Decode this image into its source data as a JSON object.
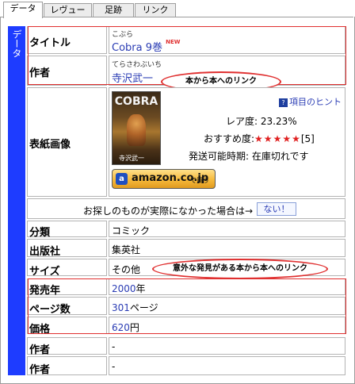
{
  "tabs": [
    {
      "label": "データ",
      "active": true
    },
    {
      "label": "レヴュー",
      "active": false
    },
    {
      "label": "足跡",
      "active": false
    },
    {
      "label": "リンク",
      "active": false
    }
  ],
  "sidebar": {
    "label": "データ"
  },
  "title": {
    "label": "タイトル",
    "ruby": "こぶら",
    "value": "Cobra 9巻",
    "badge": "NEW"
  },
  "author": {
    "label": "作者",
    "ruby": "てらさわぶいち",
    "value": "寺沢武一"
  },
  "annotations": {
    "author_link": "本から本へのリンク",
    "discovery_link": "意外な発見がある本から本へのリンク"
  },
  "cover": {
    "label": "表紙画像",
    "image_text": "COBRA",
    "image_author": "寺沢武一",
    "hint": "項目のヒント",
    "rarity_label": "レア度:",
    "rarity_value": "23.23%",
    "recommend_label": "おすすめ度:",
    "recommend_stars": "★★★★★",
    "recommend_rating": 5,
    "recommend_count": "[5]",
    "shipping_label": "発送可能時期:",
    "shipping_value": "在庫切れです",
    "amazon_logo": "amazon.co.jp",
    "amazon_buy": "で買う"
  },
  "notfound": {
    "text": "お探しのものが実際になかった場合は→",
    "button": "ない！"
  },
  "rows": {
    "category": {
      "label": "分類",
      "value": "コミック"
    },
    "publisher": {
      "label": "出版社",
      "value": "集英社"
    },
    "size": {
      "label": "サイズ",
      "value": "その他"
    },
    "release": {
      "label": "発売年",
      "value": "2000",
      "unit": "年"
    },
    "pages": {
      "label": "ページ数",
      "value": "301",
      "unit": "ページ"
    },
    "price": {
      "label": "価格",
      "value": "620",
      "unit": "円"
    },
    "author2": {
      "label": "作者",
      "value": "-"
    },
    "author3": {
      "label": "作者",
      "value": "-"
    }
  }
}
